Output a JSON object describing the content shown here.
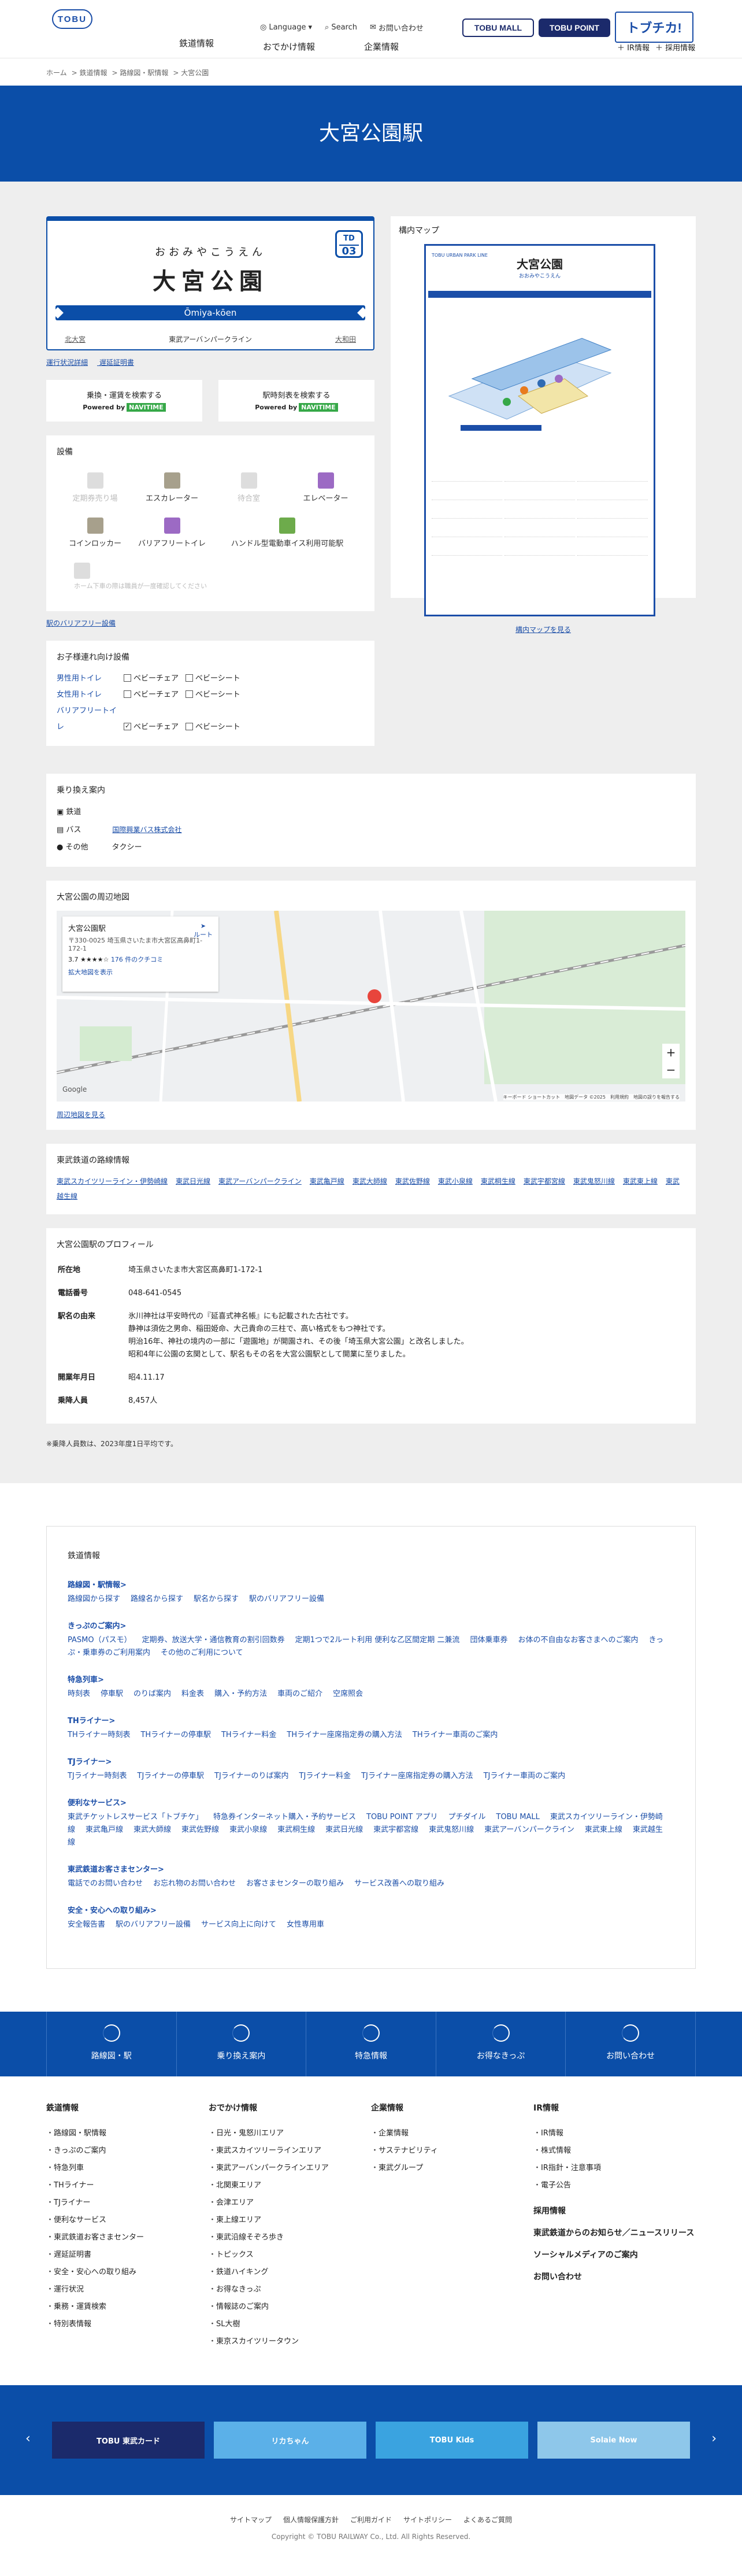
{
  "header": {
    "logo": "TOBU",
    "language": "Language",
    "search": "Search",
    "contact": "お問い合わせ",
    "tobumall": "TOBU MALL",
    "tobupoint": "TOBU POINT",
    "tobuchika": "トブチカ!",
    "nav": [
      "鉄道情報",
      "おでかけ情報",
      "企業情報"
    ],
    "ir": "IR情報",
    "ir_plus": "＋ IR情報",
    "saiyo": "＋ 採用情報"
  },
  "breadcrumb": [
    "ホーム",
    "鉄道情報",
    "路線図・駅情報",
    "大宮公園"
  ],
  "hero_title": "大宮公園駅",
  "station": {
    "kana": "おおみやこうえん",
    "name": "大宮公園",
    "romaji": "Ōmiya-kōen",
    "number_line": "TD",
    "number": "03",
    "prev": "北大宮",
    "line": "東武アーバンパークライン",
    "next": "大和田"
  },
  "links": {
    "status": "運行状況詳細",
    "delay": "遅延証明書"
  },
  "search": {
    "route": "乗換・運賃を検索する",
    "timetable": "駅時刻表を検索する",
    "powered": "Powered by",
    "navitime": "NAVITIME"
  },
  "facilities": {
    "title": "設備",
    "items": [
      "定期券売り場",
      "エスカレーター",
      "待合室",
      "エレベーター",
      "コインロッカー",
      "バリアフリートイレ",
      "ハンドル型電動車イス利用可能駅",
      "ホーム下車の際は職員が一度確認してください"
    ],
    "barrier_link": "駅のバリアフリー設備"
  },
  "child": {
    "title": "お子様連れ向け設備",
    "rows": [
      {
        "label": "男性用トイレ",
        "opts": [
          "ベビーチェア",
          "ベビーシート"
        ]
      },
      {
        "label": "女性用トイレ",
        "opts": [
          "ベビーチェア",
          "ベビーシート"
        ]
      },
      {
        "label": "バリアフリートイレ",
        "opts": [
          "ベビーチェア",
          "ベビーシート"
        ]
      }
    ]
  },
  "yard": {
    "title": "構内マップ",
    "map_title": "大宮公園",
    "map_sub": "おおみやこうえん",
    "map_brand": "TOBU URBAN PARK LINE",
    "link": "構内マップを見る"
  },
  "transfer": {
    "title": "乗り換え案内",
    "rows": [
      {
        "k": "鉄道",
        "v": ""
      },
      {
        "k": "バス",
        "v": "国際興業バス株式会社"
      },
      {
        "k": "その他",
        "v": "タクシー"
      }
    ]
  },
  "area": {
    "title": "大宮公園の周辺地図",
    "place": "大宮公園駅",
    "addr": "〒330-0025 埼玉県さいたま市大宮区高鼻町1-172-1",
    "rating": "3.7",
    "reviews": "176 件のクチコミ",
    "enlarge": "拡大地図を表示",
    "route": "ルート",
    "link": "周辺地図を見る",
    "google": "Google",
    "terms": "キーボード ショートカット　地図データ ©2025　利用規約　地図の誤りを報告する"
  },
  "lines": {
    "title": "東武鉄道の路線情報",
    "items": [
      "東武スカイツリーライン・伊勢崎線",
      "東武日光線",
      "東武アーバンパークライン",
      "東武亀戸線",
      "東武大師線",
      "東武佐野線",
      "東武小泉線",
      "東武桐生線",
      "東武宇都宮線",
      "東武鬼怒川線",
      "東武東上線",
      "東武越生線"
    ]
  },
  "profile": {
    "title": "大宮公園駅のプロフィール",
    "rows": [
      {
        "k": "所在地",
        "v": "埼玉県さいたま市大宮区高鼻町1-172-1"
      },
      {
        "k": "電話番号",
        "v": "048-641-0545"
      },
      {
        "k": "駅名の由来",
        "v": "氷川神社は平安時代の『延喜式神名帳』にも記載された古社です。\n静神は須佐之男命、稲田姫命、大己貴命の三柱で、高い格式をもつ神社です。\n明治16年、神社の境内の一部に「遊園地」が開園され、その後「埼玉県大宮公園」と改名しました。\n昭和4年に公園の玄関として、駅名もその名を大宮公園駅として開業に至りました。"
      },
      {
        "k": "開業年月日",
        "v": "昭4.11.17"
      },
      {
        "k": "乗降人員",
        "v": "8,457人"
      }
    ],
    "note": "※乗降人員数は、2023年度1日平均です。"
  },
  "sitemap": {
    "title": "鉄道情報",
    "groups": [
      {
        "h": "路線図・駅情報",
        "items": [
          "路線図から探す",
          "路線名から探す",
          "駅名から探す",
          "駅のバリアフリー設備"
        ]
      },
      {
        "h": "きっぷのご案内",
        "items": [
          "PASMO（パスモ）",
          "定期券、放送大学・通信教育の割引回数券",
          "定期1つで2ルート利用 便利な乙区間定期 二兼流",
          "団体乗車券",
          "お体の不自由なお客さまへのご案内",
          "きっぷ・乗車券のご利用案内",
          "その他のご利用について"
        ]
      },
      {
        "h": "特急列車",
        "items": [
          "時刻表",
          "停車駅",
          "のりば案内",
          "料金表",
          "購入・予約方法",
          "車両のご紹介",
          "空席照会"
        ]
      },
      {
        "h": "THライナー",
        "items": [
          "THライナー時刻表",
          "THライナーの停車駅",
          "THライナー料金",
          "THライナー座席指定券の購入方法",
          "THライナー車両のご案内"
        ]
      },
      {
        "h": "TJライナー",
        "items": [
          "TJライナー時刻表",
          "TJライナーの停車駅",
          "TJライナーのりば案内",
          "TJライナー料金",
          "TJライナー座席指定券の購入方法",
          "TJライナー車両のご案内"
        ]
      },
      {
        "h": "便利なサービス",
        "items": [
          "東武チケットレスサービス「トブチケ」",
          "特急券インターネット購入・予約サービス",
          "TOBU POINT アプリ",
          "プチダイル",
          "TOBU MALL",
          "東武スカイツリーライン・伊勢崎線",
          "東武亀戸線",
          "東武大師線",
          "東武佐野線",
          "東武小泉線",
          "東武桐生線",
          "東武日光線",
          "東武宇都宮線",
          "東武鬼怒川線",
          "東武アーバンパークライン",
          "東武東上線",
          "東武越生線"
        ]
      },
      {
        "h": "東武鉄道お客さまセンター",
        "items": [
          "電話でのお問い合わせ",
          "お忘れ物のお問い合わせ",
          "お客さまセンターの取り組み",
          "サービス改善への取り組み"
        ]
      },
      {
        "h": "安全・安心への取り組み",
        "items": [
          "安全報告書",
          "駅のバリアフリー設備",
          "サービス向上に向けて",
          "女性専用車"
        ]
      }
    ]
  },
  "footer_nav": [
    "路線図・駅",
    "乗り換え案内",
    "特急情報",
    "お得なきっぷ",
    "お問い合わせ"
  ],
  "footer_cols": [
    {
      "h": "鉄道情報",
      "items": [
        "路線図・駅情報",
        "きっぷのご案内",
        "特急列車",
        "THライナー",
        "TJライナー",
        "便利なサービス",
        "東武鉄道お客さまセンター",
        "遅延証明書",
        "安全・安心への取り組み",
        "運行状況",
        "乗務・運賃検索",
        "特別表情報"
      ]
    },
    {
      "h": "おでかけ情報",
      "items": [
        "日光・鬼怒川エリア",
        "東武スカイツリーラインエリア",
        "東武アーバンパークラインエリア",
        "北関東エリア",
        "会津エリア",
        "東上線エリア",
        "東武沿線そぞろ歩き",
        "トピックス",
        "鉄道ハイキング",
        "お得なきっぷ",
        "情報誌のご案内",
        "SL大樹",
        "東京スカイツリータウン"
      ]
    },
    {
      "h": "企業情報",
      "items": [
        "企業情報",
        "サステナビリティ",
        "東武グループ"
      ]
    },
    {
      "h": "IR情報",
      "items": [
        "IR情報",
        "株式情報",
        "IR指針・注意事項",
        "電子公告"
      ],
      "extra": [
        "採用情報",
        "東武鉄道からのお知らせ／ニュースリリース",
        "ソーシャルメディアのご案内",
        "お問い合わせ"
      ]
    }
  ],
  "banners": [
    "TOBU 東武カード",
    "リカちゃん",
    "TOBU Kids",
    "Solaie Now"
  ],
  "bottom_links": [
    "サイトマップ",
    "個人情報保護方針",
    "ご利用ガイド",
    "サイトポリシー",
    "よくあるご質問"
  ],
  "copyright": "Copyright © TOBU RAILWAY Co., Ltd. All Rights Reserved.",
  "colors": {
    "brand": "#0b4ea8",
    "navy": "#1b2a6b"
  }
}
